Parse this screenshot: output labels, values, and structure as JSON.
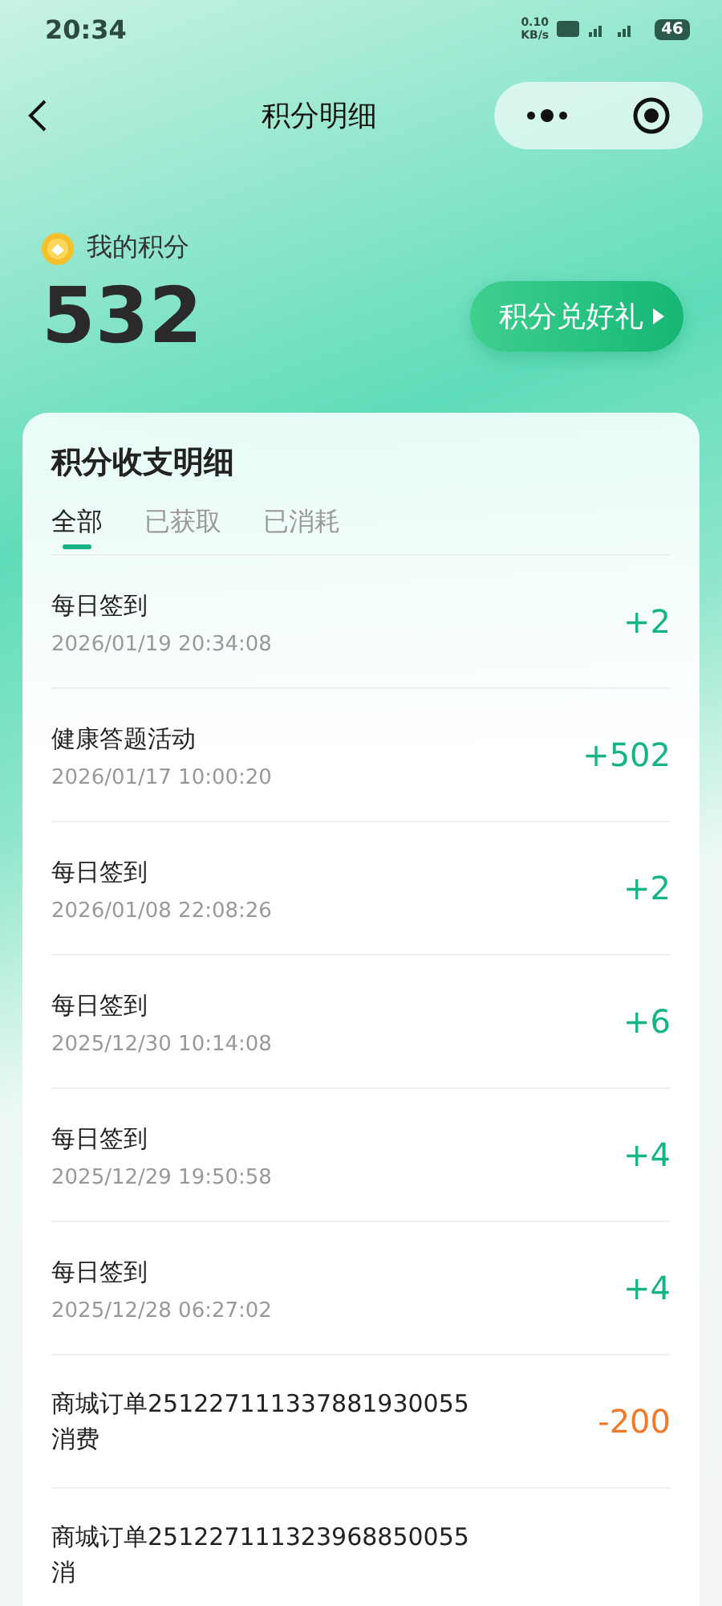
{
  "status_bar": {
    "time": "20:34",
    "speed": "0.10",
    "speed_unit": "KB/s",
    "battery": "46"
  },
  "nav": {
    "title": "积分明细"
  },
  "points": {
    "label": "我的积分",
    "value": "532",
    "button": "积分兑好礼"
  },
  "card": {
    "title": "积分收支明细"
  },
  "tabs": [
    {
      "label": "全部",
      "selected": true
    },
    {
      "label": "已获取",
      "selected": false
    },
    {
      "label": "已消耗",
      "selected": false
    }
  ],
  "records": [
    {
      "title": "每日签到",
      "date": "2026/01/19 20:34:08",
      "amount": "+2",
      "kind": "gain"
    },
    {
      "title": "健康答题活动",
      "date": "2026/01/17 10:00:20",
      "amount": "+502",
      "kind": "gain"
    },
    {
      "title": "每日签到",
      "date": "2026/01/08 22:08:26",
      "amount": "+2",
      "kind": "gain"
    },
    {
      "title": "每日签到",
      "date": "2025/12/30 10:14:08",
      "amount": "+6",
      "kind": "gain"
    },
    {
      "title": "每日签到",
      "date": "2025/12/29 19:50:58",
      "amount": "+4",
      "kind": "gain"
    },
    {
      "title": "每日签到",
      "date": "2025/12/28 06:27:02",
      "amount": "+4",
      "kind": "gain"
    },
    {
      "title": "商城订单251227111337881930055消费",
      "amount": "-200",
      "kind": "spend"
    },
    {
      "title": "商城订单251227111323968850055消"
    }
  ]
}
